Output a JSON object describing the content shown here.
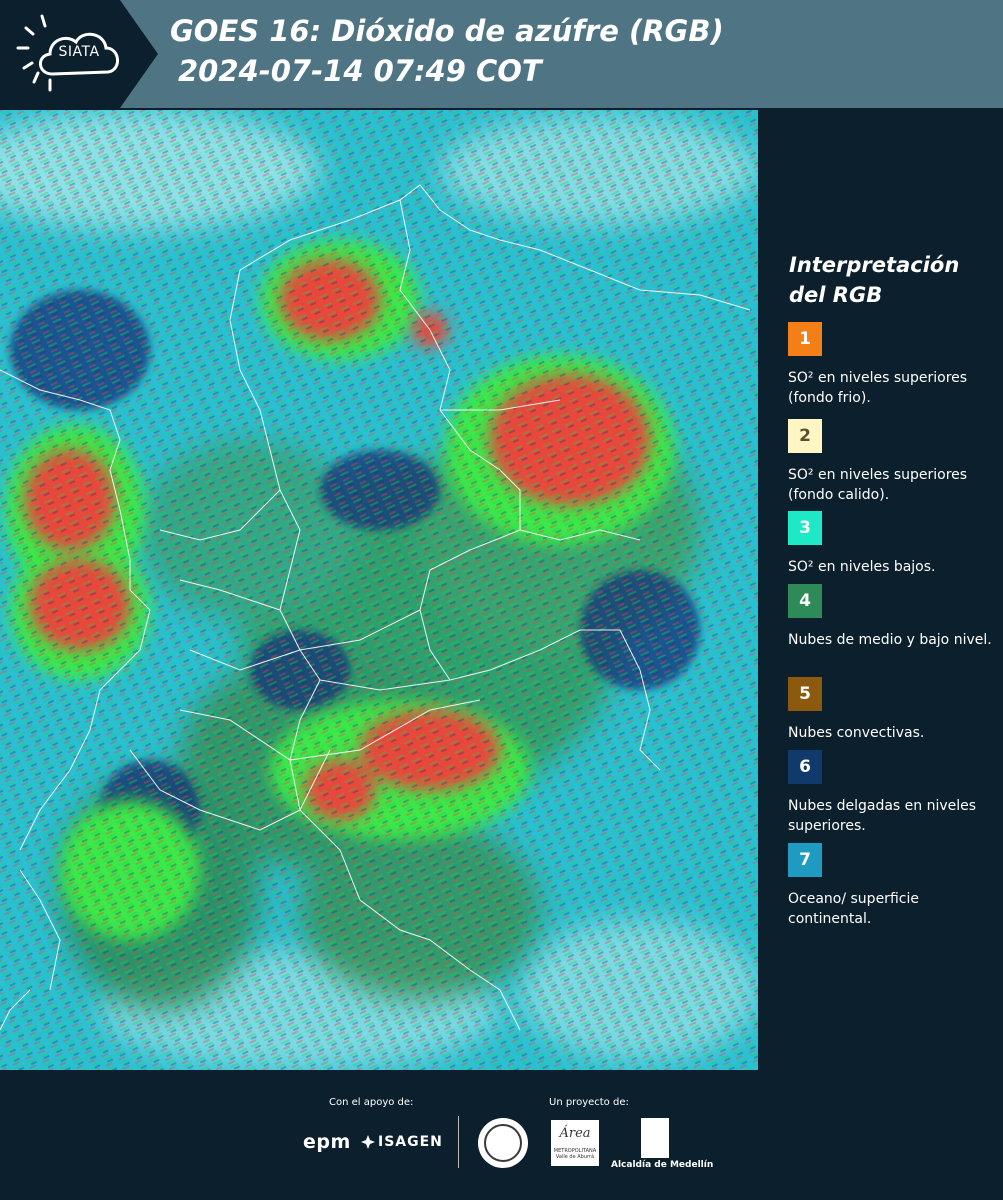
{
  "header": {
    "logo_text": "SIATA",
    "title_line1": "GOES 16: Dióxido de azúfre (RGB)",
    "title_line2": "2024-07-14 07:49 COT"
  },
  "legend": {
    "title": "Interpretación del RGB",
    "items": [
      {
        "number": "1",
        "color": "#f57f17",
        "text": "SO² en niveles superiores (fondo frio)."
      },
      {
        "number": "2",
        "color": "#fff6c4",
        "text": "SO² en niveles superiores (fondo calido)."
      },
      {
        "number": "3",
        "color": "#1de9c6",
        "text": "SO² en niveles bajos."
      },
      {
        "number": "4",
        "color": "#2e8b57",
        "text": "Nubes de medio y bajo nivel."
      },
      {
        "number": "5",
        "color": "#8b5a0f",
        "text": "Nubes convectivas."
      },
      {
        "number": "6",
        "color": "#0f3a6b",
        "text": "Nubes delgadas en niveles superiores."
      },
      {
        "number": "7",
        "color": "#1f9bc2",
        "text": "Oceano/ superficie continental."
      }
    ]
  },
  "footer": {
    "support_label": "Con el apoyo de:",
    "project_label": "Un proyecto de:",
    "epm": "epm",
    "isagen": "ISAGEN",
    "area_name": "Área",
    "area_sub": "METROPOLITANA Valle de Aburrá",
    "alcaldia": "Alcaldía de Medellín"
  },
  "colors": {
    "header_bg": "#4f7584",
    "logo_bg": "#0c1f2c",
    "page_bg": "#0c1f2c",
    "map_background": "#2bbfd3",
    "storm_red": "#e8463a",
    "storm_green": "#33d44a"
  }
}
